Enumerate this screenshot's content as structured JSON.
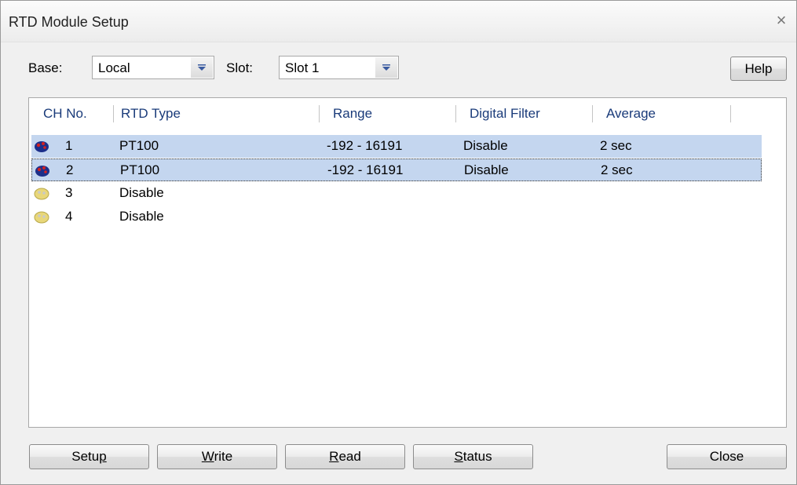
{
  "window": {
    "title": "RTD Module Setup",
    "close_glyph": "×"
  },
  "toolbar": {
    "base_label": "Base:",
    "base_value": "Local",
    "slot_label": "Slot:",
    "slot_value": "Slot 1",
    "help_label": "Help"
  },
  "table": {
    "columns": [
      "CH No.",
      "RTD Type",
      "Range",
      "Digital Filter",
      "Average"
    ],
    "rows": [
      {
        "ch": "1",
        "type": "PT100",
        "range": "-192 - 16191",
        "filter": "Disable",
        "average": "2 sec",
        "icon": "channel-active-icon",
        "selected": true
      },
      {
        "ch": "2",
        "type": "PT100",
        "range": "-192 - 16191",
        "filter": "Disable",
        "average": "2 sec",
        "icon": "channel-active-icon",
        "selected": true,
        "focused": true
      },
      {
        "ch": "3",
        "type": "Disable",
        "range": "",
        "filter": "",
        "average": "",
        "icon": "channel-disabled-icon",
        "selected": false
      },
      {
        "ch": "4",
        "type": "Disable",
        "range": "",
        "filter": "",
        "average": "",
        "icon": "channel-disabled-icon",
        "selected": false
      }
    ]
  },
  "buttons": {
    "setup": {
      "pre": "Setu",
      "accel": "p",
      "post": ""
    },
    "write": {
      "pre": "",
      "accel": "W",
      "post": "rite"
    },
    "read": {
      "pre": "",
      "accel": "R",
      "post": "ead"
    },
    "status": {
      "pre": "",
      "accel": "S",
      "post": "tatus"
    },
    "close": "Close"
  },
  "colors": {
    "selection": "#c4d6ef",
    "header_text": "#1a3b7a",
    "active_icon": "#1c2f8a",
    "active_icon_accent": "#d42020",
    "disabled_icon": "#e8d77a"
  }
}
